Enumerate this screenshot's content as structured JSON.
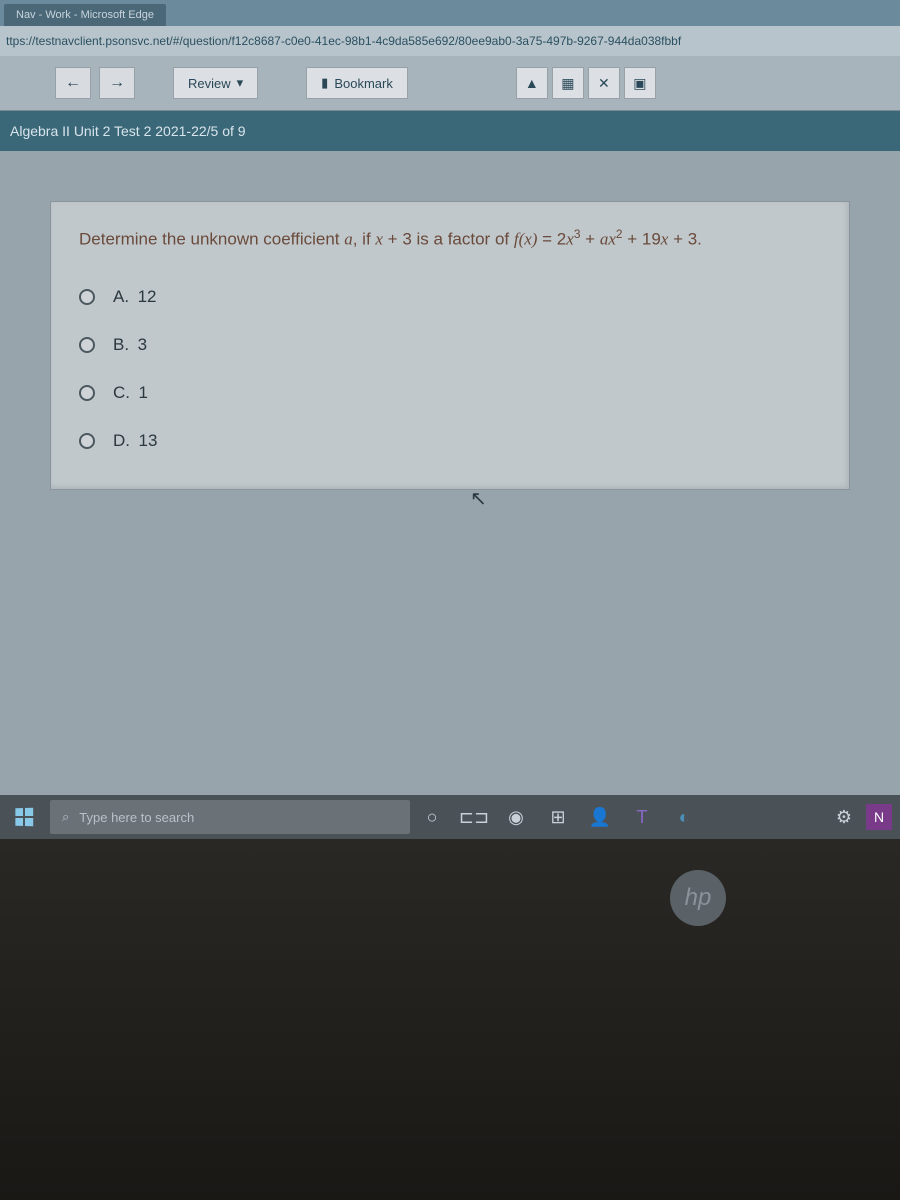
{
  "browser": {
    "tab_title": "Nav - Work - Microsoft Edge",
    "url": "ttps://testnavclient.psonsvc.net/#/question/f12c8687-c0e0-41ec-98b1-4c9da585e692/80ee9ab0-3a75-497b-9267-944da038fbbf"
  },
  "toolbar": {
    "back_icon": "←",
    "forward_icon": "→",
    "review_label": "Review",
    "review_caret": "▾",
    "bookmark_icon": "▮",
    "bookmark_label": "Bookmark",
    "pointer_icon": "▲",
    "grid_icon": "▦",
    "close_icon": "✕",
    "note_icon": "▣"
  },
  "breadcrumb": {
    "test_name": "Algebra II Unit 2 Test 2 2021-22",
    "separator": " / ",
    "progress": "5 of 9"
  },
  "question": {
    "prefix": "Determine the unknown coefficient ",
    "var": "a",
    "mid": ", if ",
    "expr1_a": "x",
    "expr1_b": " + 3",
    "mid2": "  is a factor of ",
    "func": "f(x)",
    "eq": " = 2",
    "x3": "x",
    "sup3": "3",
    "plus1": " + ",
    "ax": "ax",
    "sup2": "2",
    "plus2": " + 19",
    "x1": "x",
    "end": " + 3.",
    "options": [
      {
        "letter": "A.",
        "value": "12"
      },
      {
        "letter": "B.",
        "value": "3"
      },
      {
        "letter": "C.",
        "value": "1"
      },
      {
        "letter": "D.",
        "value": "13"
      }
    ]
  },
  "taskbar": {
    "search_placeholder": "Type here to search",
    "icons": {
      "cortana": "○",
      "taskview": "⊏⊐",
      "edge": "◉",
      "store": "⊞",
      "people": "👤",
      "teams": "T",
      "edge2": "◐",
      "settings": "⚙",
      "onenote": "N"
    }
  },
  "hp_label": "hp"
}
